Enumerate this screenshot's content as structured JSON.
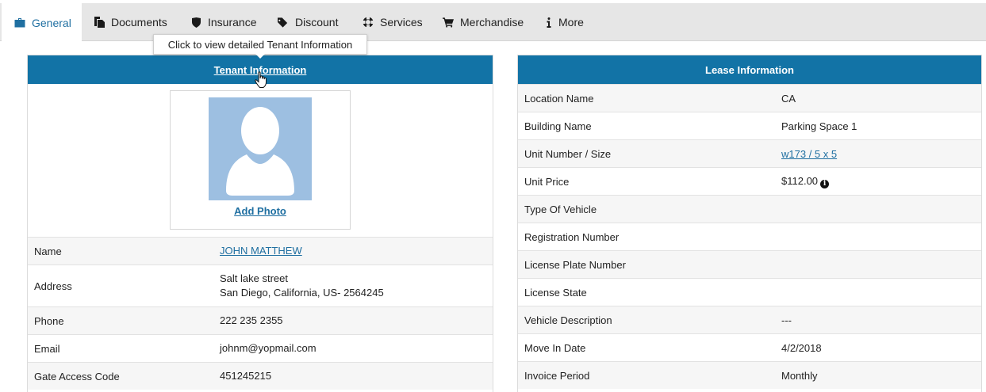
{
  "tabs": [
    {
      "label": "General",
      "icon": "briefcase-icon",
      "active": true
    },
    {
      "label": "Documents",
      "icon": "documents-icon"
    },
    {
      "label": "Insurance",
      "icon": "shield-icon"
    },
    {
      "label": "Discount",
      "icon": "tag-icon"
    },
    {
      "label": "Services",
      "icon": "lifebuoy-icon"
    },
    {
      "label": "Merchandise",
      "icon": "cart-icon"
    },
    {
      "label": "More",
      "icon": "info-icon"
    }
  ],
  "tooltip": "Click to view detailed Tenant Information",
  "tenant": {
    "header": "Tenant Information",
    "add_photo": "Add Photo",
    "rows": [
      {
        "label": "Name",
        "value": "JOHN MATTHEW"
      },
      {
        "label": "Address",
        "value_line1": "Salt lake street",
        "value_line2": "San Diego, California, US- 2564245"
      },
      {
        "label": "Phone",
        "value": "222 235 2355"
      },
      {
        "label": "Email",
        "value": "johnm@yopmail.com"
      },
      {
        "label": "Gate Access Code",
        "value": "451245215"
      }
    ]
  },
  "lease": {
    "header": "Lease Information",
    "rows": [
      {
        "label": "Location Name",
        "value": "CA"
      },
      {
        "label": "Building Name",
        "value": "Parking Space 1"
      },
      {
        "label": "Unit Number / Size",
        "value": "w173 / 5 x 5"
      },
      {
        "label": "Unit Price",
        "value": "$112.00"
      },
      {
        "label": "Type Of Vehicle",
        "value": ""
      },
      {
        "label": "Registration Number",
        "value": ""
      },
      {
        "label": "License Plate Number",
        "value": ""
      },
      {
        "label": "License State",
        "value": ""
      },
      {
        "label": "Vehicle Description",
        "value": "---"
      },
      {
        "label": "Move In Date",
        "value": "4/2/2018"
      },
      {
        "label": "Invoice Period",
        "value": "Monthly"
      }
    ]
  },
  "colors": {
    "accent": "#1273a6",
    "link": "#1f6fa1",
    "avatar_bg": "#9dbfe1"
  }
}
